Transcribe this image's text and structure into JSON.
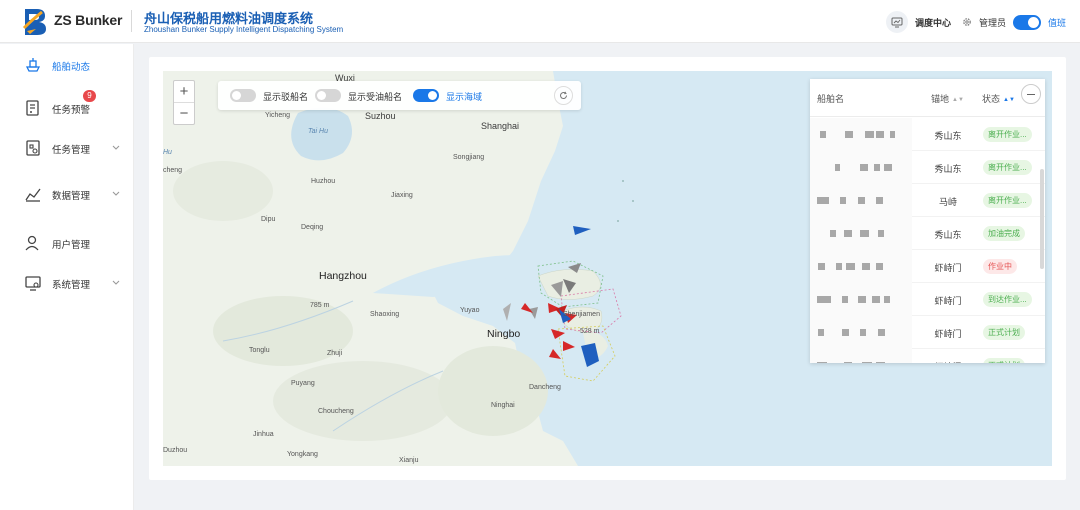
{
  "header": {
    "brand": "ZS Bunker",
    "title_cn": "舟山保税船用燃料油调度系统",
    "title_en": "Zhoushan Bunker Supply Intelligent Dispatching System",
    "dispatch_center": "调度中心",
    "admin": "管理员",
    "shift": "值班"
  },
  "sidebar": {
    "items": [
      {
        "label": "船舶动态",
        "icon": "ship-icon",
        "active": true
      },
      {
        "label": "任务预警",
        "icon": "alert-doc-icon",
        "badge": "9"
      },
      {
        "label": "任务管理",
        "icon": "task-icon"
      },
      {
        "label": "数据管理",
        "icon": "chart-icon"
      },
      {
        "label": "用户管理",
        "icon": "user-icon"
      },
      {
        "label": "系统管理",
        "icon": "monitor-settings-icon"
      }
    ]
  },
  "map": {
    "zoom_in": "+",
    "zoom_out": "−",
    "toggles": [
      {
        "label": "显示驳船名",
        "on": false
      },
      {
        "label": "显示受油船名",
        "on": false
      },
      {
        "label": "显示海域",
        "on": true
      }
    ],
    "places": {
      "wuxi": "Wuxi",
      "suzhou": "Suzhou",
      "shanghai": "Shanghai",
      "yicheng": "Yicheng",
      "taihu": "Tai Hu",
      "songjiang": "Songjiang",
      "huzhou": "Huzhou",
      "jiaxing": "Jiaxing",
      "dipu": "Dipu",
      "deqing": "Deqing",
      "hangzhou": "Hangzhou",
      "shaoxing": "Shaoxing",
      "yuyao": "Yuyao",
      "ningbo": "Ningbo",
      "shenjiamen": "Shenjiamen",
      "tonglu": "Tonglu",
      "zhuji": "Zhuji",
      "puyang": "Puyang",
      "choucheng": "Choucheng",
      "ninghai": "Ninghai",
      "dancheng": "Dancheng",
      "jinhua": "Jinhua",
      "yongkang": "Yongkang",
      "xianju": "Xianju",
      "duzhou": "Duzhou",
      "chengyu": "cheng",
      "hu_left": "Hu",
      "elev_785": "785 m",
      "elev_528": "528 m"
    }
  },
  "ship_panel": {
    "headers": {
      "name": "船舶名",
      "anchorage": "锚地",
      "status": "状态"
    },
    "rows": [
      {
        "anchorage": "秀山东",
        "status": "离开作业...",
        "tone": "green"
      },
      {
        "anchorage": "秀山东",
        "status": "离开作业...",
        "tone": "green"
      },
      {
        "anchorage": "马峙",
        "status": "离开作业...",
        "tone": "green"
      },
      {
        "anchorage": "秀山东",
        "status": "加油完成",
        "tone": "green"
      },
      {
        "anchorage": "虾峙门",
        "status": "作业中",
        "tone": "red"
      },
      {
        "anchorage": "虾峙门",
        "status": "到达作业...",
        "tone": "green"
      },
      {
        "anchorage": "虾峙门",
        "status": "正式计划",
        "tone": "green"
      },
      {
        "anchorage": "虾峙门",
        "status": "正式计划",
        "tone": "green"
      }
    ]
  },
  "colors": {
    "accent": "#1a78e8",
    "title": "#1a5fb4",
    "badge": "#e8484b",
    "ship_red": "#d62828",
    "ship_blue": "#1f5fbf",
    "ship_gray": "#8a8a8a",
    "sea": "#d6e9f3",
    "land": "#eef2ea"
  }
}
